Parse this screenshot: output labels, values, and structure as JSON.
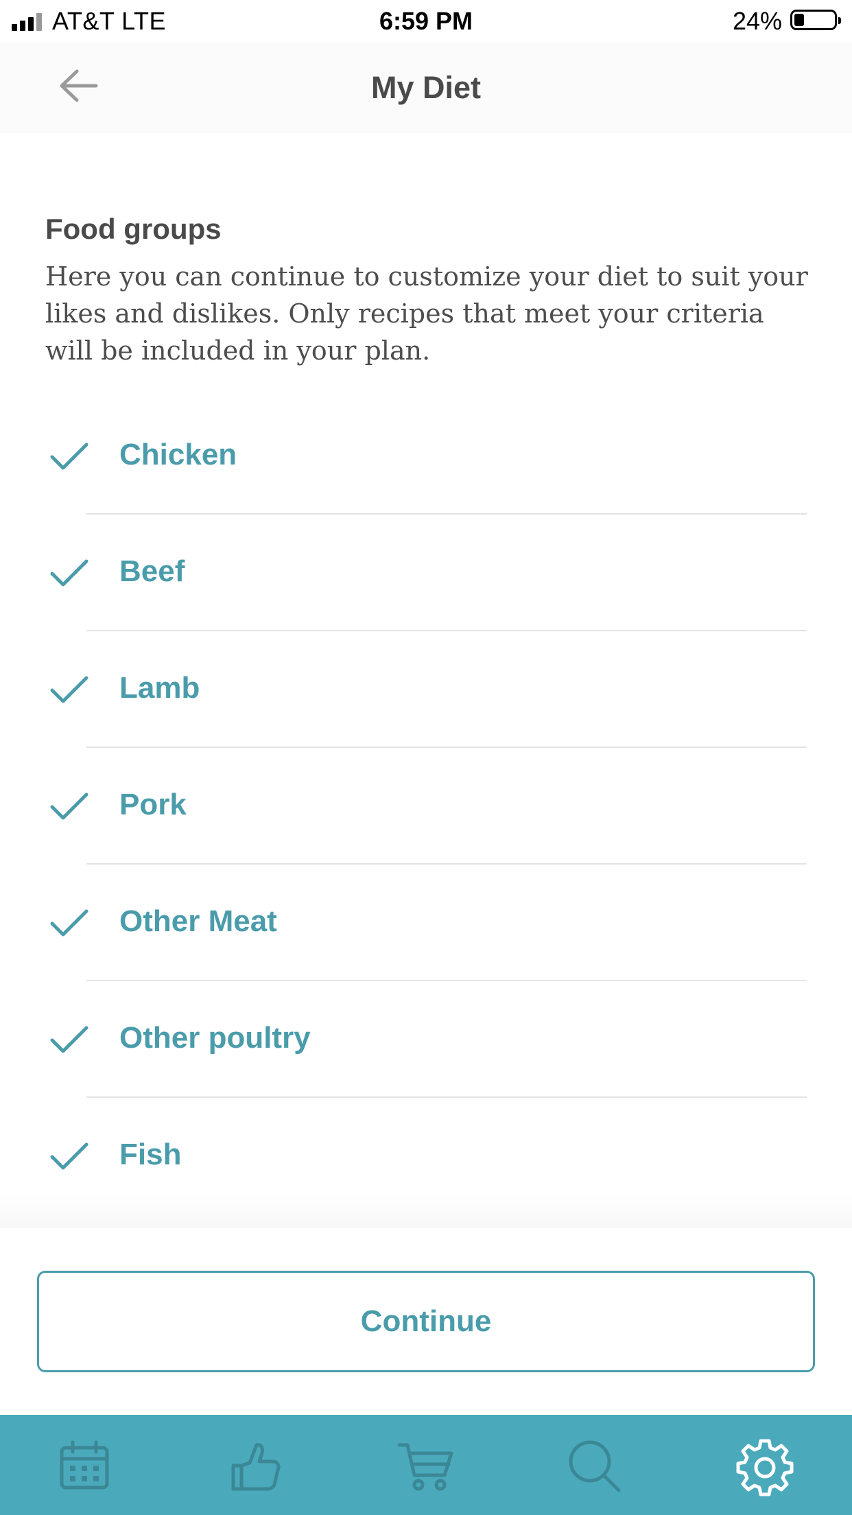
{
  "status_bar": {
    "carrier": "AT&T   LTE",
    "time": "6:59 PM",
    "battery": "24%"
  },
  "nav": {
    "title": "My Diet",
    "back_icon": "arrow-left-icon"
  },
  "section": {
    "title": "Food groups",
    "description": "Here you can continue to customize your diet to suit your likes and dislikes. Only recipes that meet your criteria will be included in your plan."
  },
  "food_groups": [
    {
      "label": "Chicken",
      "checked": true
    },
    {
      "label": "Beef",
      "checked": true
    },
    {
      "label": "Lamb",
      "checked": true
    },
    {
      "label": "Pork",
      "checked": true
    },
    {
      "label": "Other Meat",
      "checked": true
    },
    {
      "label": "Other poultry",
      "checked": true
    },
    {
      "label": "Fish",
      "checked": true
    }
  ],
  "footer": {
    "continue_label": "Continue"
  },
  "tab_bar": {
    "items": [
      "calendar-icon",
      "thumbs-up-icon",
      "cart-icon",
      "search-icon",
      "gear-icon"
    ],
    "active": "gear-icon"
  },
  "colors": {
    "accent": "#4a9cab",
    "tab_bar_bg": "#4aaabb",
    "tab_icon_inactive": "#3b8796",
    "tab_icon_active": "#ffffff"
  }
}
